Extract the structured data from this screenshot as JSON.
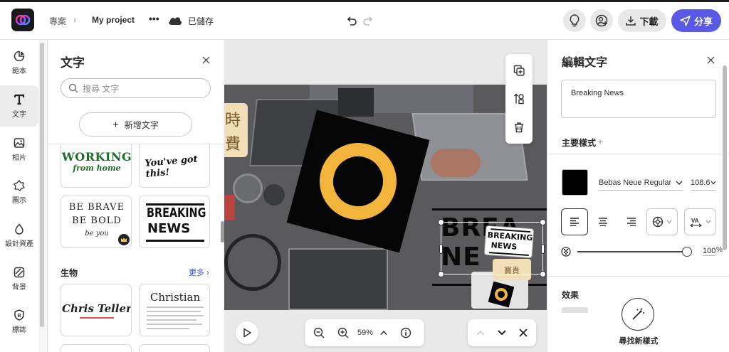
{
  "header": {
    "breadcrumb_root": "專案",
    "project_name": "My project",
    "saved_label": "已儲存",
    "download_label": "下載",
    "share_label": "分享"
  },
  "rail": [
    {
      "label": "範本",
      "icon": "template-icon"
    },
    {
      "label": "文字",
      "icon": "text-icon"
    },
    {
      "label": "相片",
      "icon": "photo-icon"
    },
    {
      "label": "圖示",
      "icon": "icons-icon"
    },
    {
      "label": "設計資產",
      "icon": "brand-assets-icon"
    },
    {
      "label": "背景",
      "icon": "background-icon"
    },
    {
      "label": "標誌",
      "icon": "logo-icon"
    }
  ],
  "text_panel": {
    "title": "文字",
    "search_placeholder": "搜尋 文字",
    "add_text_label": "新增文字",
    "cards_row1": [
      "WORKING",
      "from home",
      "You've got this!"
    ],
    "cards_row2": {
      "brave": [
        "BE BRAVE",
        "BE BOLD",
        "be you"
      ],
      "breaking": [
        "BREAKING",
        "NEWS"
      ]
    },
    "section_title": "生物",
    "more_label": "更多",
    "cards_row3": {
      "signature": "Chris Teller",
      "christian": "Christian"
    }
  },
  "canvas": {
    "zoom": "59%",
    "side_text": [
      "時",
      "費"
    ],
    "breaking_small": [
      "BREAKING",
      "NEWS"
    ],
    "bg_text": [
      "BREA",
      "NE"
    ],
    "gold_tag": "寶貴"
  },
  "right_panel": {
    "title": "編輯文字",
    "text_value": "Breaking News",
    "main_style_label": "主要樣式",
    "font_name": "Bebas Neue Regular",
    "font_size": "108.6",
    "text_color": "#000000",
    "opacity_value": "100",
    "opacity_unit": "%",
    "effects_label": "效果",
    "find_style_label": "尋找新樣式"
  },
  "colors": {
    "accent": "#5a59e6",
    "ring": "#f2b43a"
  }
}
